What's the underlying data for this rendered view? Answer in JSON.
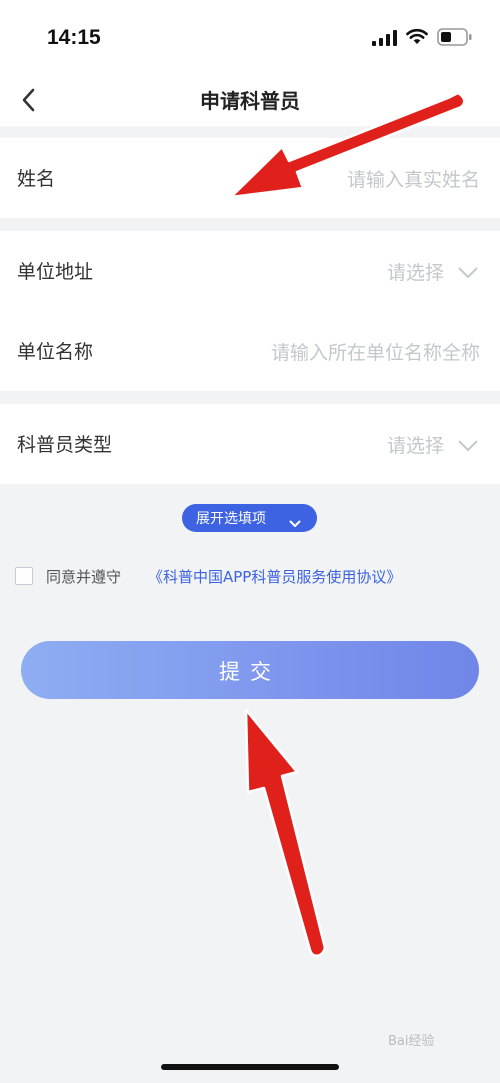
{
  "status_bar": {
    "time": "14:15",
    "icons": [
      "cellular-signal-icon",
      "wifi-icon",
      "battery-icon"
    ]
  },
  "nav": {
    "title": "申请科普员",
    "back_icon": "chevron-left-icon"
  },
  "form": {
    "name": {
      "label": "姓名",
      "placeholder": "请输入真实姓名"
    },
    "unit_address": {
      "label": "单位地址",
      "placeholder": "请选择"
    },
    "unit_name": {
      "label": "单位名称",
      "placeholder": "请输入所在单位名称全称"
    },
    "science_type": {
      "label": "科普员类型",
      "placeholder": "请选择"
    }
  },
  "expand_button": {
    "label": "展开选填项"
  },
  "agreement": {
    "checked": false,
    "prefix": "同意并遵守",
    "link": "《科普中国APP科普员服务使用协议》"
  },
  "submit": {
    "label": "提交"
  },
  "watermark": "Bai经验",
  "colors": {
    "accent": "#3d62e2",
    "annotation_arrow": "#e0201b",
    "submit_gradient_start": "#8eadf2",
    "submit_gradient_end": "#6f86e8"
  }
}
